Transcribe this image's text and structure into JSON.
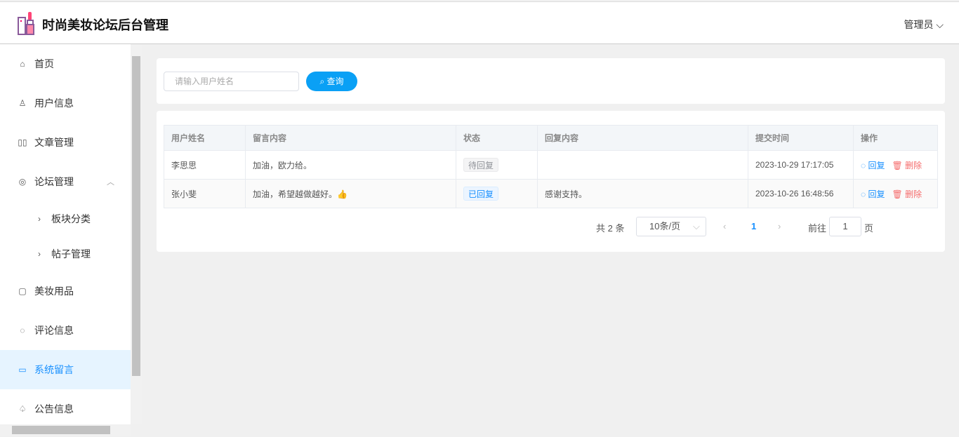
{
  "header": {
    "title": "时尚美妆论坛后台管理",
    "user": "管理员"
  },
  "sidebar": {
    "items": [
      {
        "label": "首页",
        "icon": "home-icon"
      },
      {
        "label": "用户信息",
        "icon": "user-icon"
      },
      {
        "label": "文章管理",
        "icon": "book-icon"
      },
      {
        "label": "论坛管理",
        "icon": "forum-icon"
      },
      {
        "label": "板块分类",
        "icon": "chevron-right-icon"
      },
      {
        "label": "帖子管理",
        "icon": "chevron-right-icon"
      },
      {
        "label": "美妆用品",
        "icon": "product-icon"
      },
      {
        "label": "评论信息",
        "icon": "comment-icon"
      },
      {
        "label": "系统留言",
        "icon": "message-icon"
      },
      {
        "label": "公告信息",
        "icon": "bell-icon"
      }
    ]
  },
  "search": {
    "placeholder": "请输入用户姓名",
    "button": "查询"
  },
  "table": {
    "headers": [
      "用户姓名",
      "留言内容",
      "状态",
      "回复内容",
      "提交时间",
      "操作"
    ],
    "rows": [
      {
        "name": "李思思",
        "content": "加油，欧力给。",
        "status": "待回复",
        "reply": "",
        "time": "2023-10-29 17:17:05"
      },
      {
        "name": "张小斐",
        "content": "加油，希望越做越好。👍",
        "status": "已回复",
        "reply": "感谢支持。",
        "time": "2023-10-26 16:48:56"
      }
    ],
    "reply_label": "回复",
    "delete_label": "删除"
  },
  "pagination": {
    "total": "共 2 条",
    "page_size": "10条/页",
    "current": "1",
    "goto": "前往",
    "goto_value": "1",
    "page_suffix": "页"
  },
  "colors": {
    "primary": "#0aa0f5",
    "danger": "#f56c6c"
  }
}
